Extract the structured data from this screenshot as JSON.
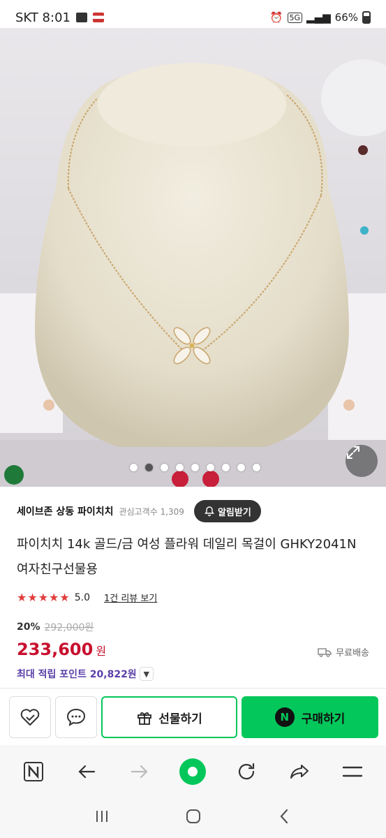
{
  "status_bar": {
    "carrier_time": "SKT 8:01",
    "network": "5G",
    "battery": "66%"
  },
  "gallery": {
    "dot_count": 9,
    "active_index": 1
  },
  "seller": {
    "name": "세이브존 상동 파이치치",
    "interest_label": "관심고객수 1,309",
    "alarm_label": "알림받기"
  },
  "product": {
    "title": "파이치치 14k 골드/금 여성 플라워 데일리 목걸이 GHKY2041N 여자친구선물용",
    "stars": "★★★★★",
    "rating": "5.0",
    "review_link": "1건 리뷰 보기",
    "discount": "20%",
    "original_price": "292,000원",
    "price": "233,600",
    "price_unit": "원",
    "shipping": "무료배송",
    "points": "최대 적립 포인트 20,822원"
  },
  "actions": {
    "gift_label": "선물하기",
    "buy_label": "구매하기",
    "n_badge": "N"
  },
  "colors": {
    "naver_green": "#03c75a",
    "price_red": "#c8102e",
    "points_purple": "#5a3fa8"
  }
}
